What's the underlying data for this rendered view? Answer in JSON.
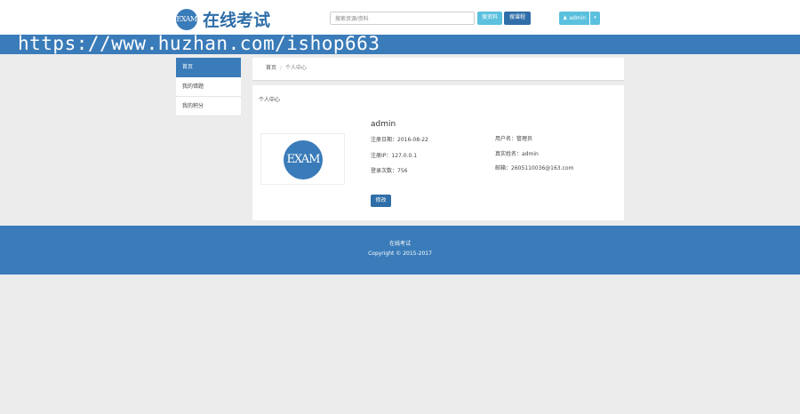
{
  "header": {
    "logo_badge": "EXAM",
    "logo_title": "在线考试",
    "search_placeholder": "搜索资源/资料",
    "search_resource_label": "搜资料",
    "search_course_label": "搜课程",
    "user_label": "admin",
    "user_caret": "▾"
  },
  "watermark": "https://www.huzhan.com/ishop663",
  "sidebar": {
    "items": [
      {
        "label": "首页",
        "active": true
      },
      {
        "label": "我的错题",
        "active": false
      },
      {
        "label": "我的积分",
        "active": false
      }
    ]
  },
  "breadcrumb": {
    "home": "首页",
    "separator": "/",
    "current": "个人中心"
  },
  "profile": {
    "panel_title": "个人中心",
    "avatar_text": "EXAM",
    "username": "admin",
    "register_date": "注册日期：2016-08-22",
    "register_ip": "注册IP：127.0.0.1",
    "login_count": "登录次数：756",
    "user_type": "用户名：管理员",
    "real_name": "真实姓名：admin",
    "email": "邮箱：2605110036@163.com",
    "edit_button": "修改"
  },
  "footer": {
    "title": "在线考试",
    "copyright": "Copyright © 2015-2017"
  },
  "colors": {
    "brand_blue": "#3a7bb9",
    "info_cyan": "#5bc0de",
    "dark_blue": "#2f6ea8"
  }
}
